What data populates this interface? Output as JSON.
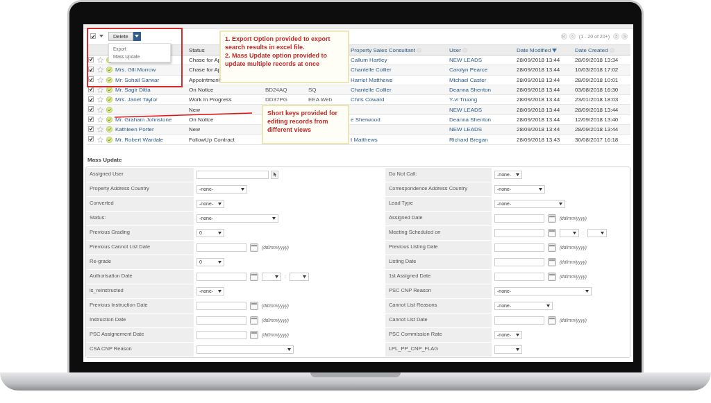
{
  "toolbar": {
    "select_all_checked": true,
    "action_button": "Delete",
    "menu": [
      "Export",
      "Mass Update"
    ],
    "pagination": "(1 - 20 of 20+)"
  },
  "table": {
    "columns": [
      {
        "kind": "link"
      },
      {
        "kind": "text",
        "label": "Status"
      },
      {
        "kind": "muted"
      },
      {
        "kind": "muted"
      },
      {
        "kind": "link",
        "label": "Property Sales Consultant",
        "sorted": false
      },
      {
        "kind": "link",
        "label": "User",
        "sorted": false
      },
      {
        "kind": "text",
        "label": "Date Modified",
        "sorted": true
      },
      {
        "kind": "text",
        "label": "Date Created",
        "sorted": false
      }
    ],
    "rows": [
      {
        "checked": true,
        "starred": false,
        "cells": [
          null,
          "Chase for Ap",
          null,
          null,
          "Callum Hartley",
          "NEW LEADS",
          "28/09/2018 13:44",
          "28/09/2018 13:34"
        ]
      },
      {
        "checked": true,
        "starred": false,
        "cells": [
          "Mrs. Gill Morrow",
          "Chase for Ap",
          null,
          null,
          "Chantelle Collier",
          "Carolyn Pearce",
          "28/09/2018 13:44",
          "10/03/2018 17:02"
        ]
      },
      {
        "checked": true,
        "starred": false,
        "cells": [
          "Mr. Sohail Sarwar",
          "Appointment",
          null,
          null,
          "Harriet Matthews",
          "Michael Caster",
          "28/09/2018 13:44",
          "28/09/2018 10:01"
        ]
      },
      {
        "checked": true,
        "starred": false,
        "cells": [
          "Mr. Sagir Ditta",
          "On Notice",
          "BD24AQ",
          "SQ",
          "Chantelle Collier",
          "Deanna Shenton",
          "28/09/2018 13:44",
          "03/08/2018 16:30"
        ]
      },
      {
        "checked": true,
        "starred": false,
        "cells": [
          "Mrs. Janet Taylor",
          "Work In Progress",
          "DD37PG",
          "EEA Web",
          "Chris Coward",
          "Y-vi Truong",
          "28/09/2018 13:44",
          "23/01/2018 18:03"
        ]
      },
      {
        "checked": true,
        "starred": false,
        "cells": [
          null,
          "New",
          null,
          null,
          null,
          "NEW LEADS",
          "28/09/2018 13:44",
          "28/09/2018 13:44"
        ]
      },
      {
        "checked": true,
        "starred": false,
        "cells": [
          "Mr. Graham Johnstone",
          "On Notice",
          null,
          null,
          "e Sherwood",
          "Deanna Shenton",
          "28/09/2018 13:44",
          "12/09/2018 13:40"
        ]
      },
      {
        "checked": true,
        "starred": false,
        "cells": [
          "Kathleen Porter",
          "New",
          null,
          null,
          null,
          "NEW LEADS",
          "28/09/2018 13:44",
          "28/09/2018 13:44"
        ]
      },
      {
        "checked": true,
        "starred": false,
        "cells": [
          "Mr. Robert Wardale",
          "FollowUp Contract",
          null,
          null,
          "t Matthews",
          "Richard Bregan",
          "28/09/2018 13:43",
          "30/08/2017 16:18"
        ]
      }
    ]
  },
  "annotations": [
    {
      "paragraphs": [
        "1. Export Option provided to export search results in excel file.",
        "2. Mass Update option provided to update multiple records at once"
      ]
    },
    {
      "paragraphs": [
        "Short keys provided for editing records from different views"
      ]
    }
  ],
  "mass_update": {
    "title": "Mass Update",
    "left_fields": [
      {
        "label": "Assigned User",
        "kind": "lookup"
      },
      {
        "label": "Property Address Country",
        "kind": "select",
        "value": "-none-"
      },
      {
        "label": "Converted",
        "kind": "select",
        "value": "-none-"
      },
      {
        "label": "Status:",
        "kind": "select",
        "value": "-none-"
      },
      {
        "label": "Previous Grading",
        "kind": "select",
        "value": "0"
      },
      {
        "label": "Previous Cannot List Date",
        "kind": "date",
        "hint": "(dd/mm/yyyy)"
      },
      {
        "label": "Re-grade",
        "kind": "select",
        "value": "0"
      },
      {
        "label": "Authorisation Date",
        "kind": "datetime",
        "separator": ":"
      },
      {
        "label": "is_reinstructed",
        "kind": "select",
        "value": "-none-"
      },
      {
        "label": "Previous Instruction Date",
        "kind": "date",
        "hint": "(dd/mm/yyyy)"
      },
      {
        "label": "Instruction Date",
        "kind": "date",
        "hint": "(dd/mm/yyyy)"
      },
      {
        "label": "PSC Assignement Date",
        "kind": "date",
        "hint": "(dd/mm/yyyy)"
      },
      {
        "label": "CSA CNP Reason",
        "kind": "select"
      }
    ],
    "right_fields": [
      {
        "label": "Do Not Call:",
        "kind": "select",
        "value": "-none-"
      },
      {
        "label": "Correspondence Address Country",
        "kind": "select",
        "value": "-none-"
      },
      {
        "label": "Lead Type",
        "kind": "select",
        "value": "-none-"
      },
      {
        "label": "Assigned Date",
        "kind": "date",
        "hint": "(dd/mm/yyyy)"
      },
      {
        "label": "Meeting Scheduled on",
        "kind": "datetime",
        "separator": ":"
      },
      {
        "label": "Previous Listing Date",
        "kind": "date",
        "hint": "(dd/mm/yyyy)"
      },
      {
        "label": "Listing Date",
        "kind": "date",
        "hint": "(dd/mm/yyyy)"
      },
      {
        "label": "1st Assigned Date",
        "kind": "date",
        "hint": "(dd/mm/yyyy)"
      },
      {
        "label": "PSC CNP Reason",
        "kind": "select",
        "value": "-none-"
      },
      {
        "label": "Cannot List Reasons",
        "kind": "select",
        "value": "-none-"
      },
      {
        "label": "Cannot List Date",
        "kind": "date",
        "hint": "(dd/mm/yyyy)"
      },
      {
        "label": "PSC Commission Rate",
        "kind": "select",
        "value": "-none-"
      },
      {
        "label": "LPL_PP_CNP_FLAG",
        "kind": "select"
      }
    ]
  }
}
